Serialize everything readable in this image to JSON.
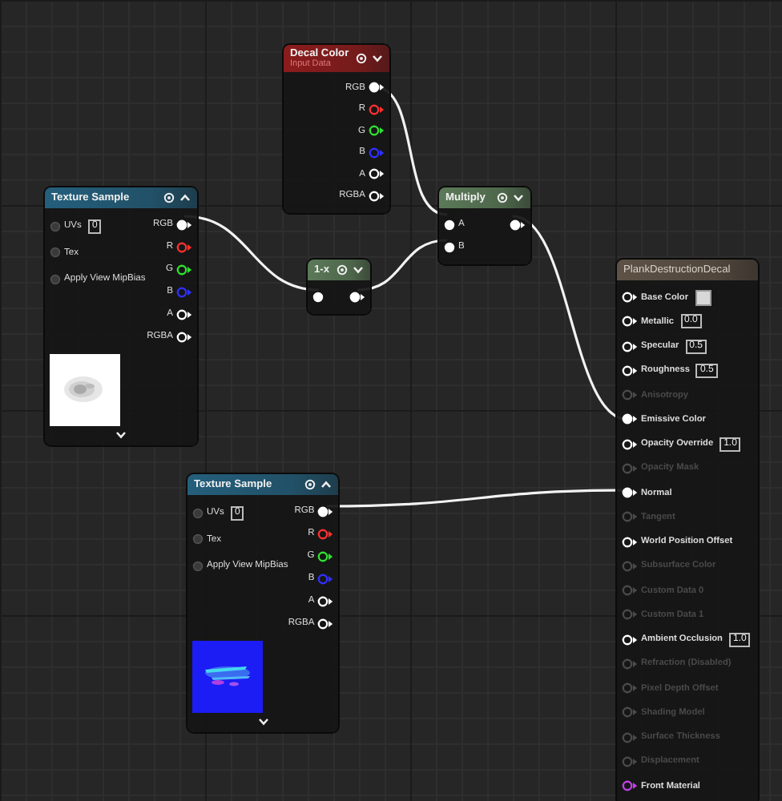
{
  "nodes": [
    {
      "kind": "input",
      "title": "Decal Color",
      "subtitle": "Input Data",
      "color": "#8c1c1c",
      "expanded": false,
      "outputs": [
        {
          "label": "RGB",
          "color": "#ffffff",
          "connected": true
        },
        {
          "label": "R",
          "color": "#ff3030",
          "connected": false
        },
        {
          "label": "G",
          "color": "#30e030",
          "connected": false
        },
        {
          "label": "B",
          "color": "#3030ff",
          "connected": false
        },
        {
          "label": "A",
          "color": "#ffffff",
          "connected": false
        },
        {
          "label": "RGBA",
          "color": "#ffffff",
          "connected": false
        }
      ]
    },
    {
      "kind": "texture",
      "title": "Texture Sample",
      "color": "#245f7c",
      "expanded": true,
      "inputs": [
        {
          "label": "UVs",
          "value": "0",
          "connected": false,
          "enabled": true
        },
        {
          "label": "Tex",
          "connected": false,
          "enabled": true
        },
        {
          "label": "Apply View MipBias",
          "connected": false,
          "enabled": true
        }
      ],
      "outputs": [
        {
          "label": "RGB",
          "color": "#ffffff",
          "connected": true
        },
        {
          "label": "R",
          "color": "#ff3030",
          "connected": false
        },
        {
          "label": "G",
          "color": "#30e030",
          "connected": false
        },
        {
          "label": "B",
          "color": "#3030ff",
          "connected": false
        },
        {
          "label": "A",
          "color": "#ffffff",
          "connected": false
        },
        {
          "label": "RGBA",
          "color": "#ffffff",
          "connected": false
        }
      ]
    },
    {
      "kind": "math",
      "title": "Multiply",
      "color": "#5b7a58",
      "expanded": false,
      "inputs": [
        {
          "label": "A",
          "connected": true,
          "enabled": true
        },
        {
          "label": "B",
          "connected": true,
          "enabled": true
        }
      ],
      "outputs": [
        {
          "color": "#ffffff",
          "connected": true
        }
      ]
    },
    {
      "kind": "math",
      "title": "1-x",
      "color": "#5b7a58",
      "expanded": false,
      "inputs": [
        {
          "connected": true,
          "enabled": true
        }
      ],
      "outputs": [
        {
          "color": "#ffffff",
          "connected": true
        }
      ]
    },
    {
      "kind": "result",
      "title": "PlankDestructionDecal",
      "color": "#5e5246",
      "inputs": [
        {
          "label": "Base Color",
          "kind": "swatch",
          "color": "#d8d8d8",
          "connected": false,
          "enabled": true
        },
        {
          "label": "Metallic",
          "value": "0.0",
          "connected": false,
          "enabled": true
        },
        {
          "label": "Specular",
          "value": "0.5",
          "connected": false,
          "enabled": true
        },
        {
          "label": "Roughness",
          "value": "0.5",
          "connected": false,
          "enabled": true
        },
        {
          "label": "Anisotropy",
          "connected": false,
          "enabled": false
        },
        {
          "label": "Emissive Color",
          "connected": true,
          "enabled": true
        },
        {
          "label": "Opacity Override",
          "value": "1.0",
          "connected": false,
          "enabled": true
        },
        {
          "label": "Opacity Mask",
          "connected": false,
          "enabled": false
        },
        {
          "label": "Normal",
          "connected": true,
          "enabled": true
        },
        {
          "label": "Tangent",
          "connected": false,
          "enabled": false
        },
        {
          "label": "World Position Offset",
          "connected": false,
          "enabled": true
        },
        {
          "label": "Subsurface Color",
          "connected": false,
          "enabled": false
        },
        {
          "label": "Custom Data 0",
          "connected": false,
          "enabled": false
        },
        {
          "label": "Custom Data 1",
          "connected": false,
          "enabled": false
        },
        {
          "label": "Ambient Occlusion",
          "value": "1.0",
          "connected": false,
          "enabled": true
        },
        {
          "label": "Refraction (Disabled)",
          "connected": false,
          "enabled": false
        },
        {
          "label": "Pixel Depth Offset",
          "connected": false,
          "enabled": false
        },
        {
          "label": "Shading Model",
          "connected": false,
          "enabled": false
        },
        {
          "label": "Surface Thickness",
          "connected": false,
          "enabled": false
        },
        {
          "label": "Displacement",
          "connected": false,
          "enabled": false
        },
        {
          "label": "Front Material",
          "kind": "pin",
          "color": "#c040e8",
          "connected": false,
          "enabled": true
        }
      ]
    },
    {
      "kind": "texture",
      "title": "Texture Sample",
      "color": "#245f7c",
      "expanded": true,
      "inputs": [
        {
          "label": "UVs",
          "value": "0",
          "connected": false,
          "enabled": true
        },
        {
          "label": "Tex",
          "connected": false,
          "enabled": true
        },
        {
          "label": "Apply View MipBias",
          "connected": false,
          "enabled": true
        }
      ],
      "outputs": [
        {
          "label": "RGB",
          "color": "#ffffff",
          "connected": true
        },
        {
          "label": "R",
          "color": "#ff3030",
          "connected": false
        },
        {
          "label": "G",
          "color": "#30e030",
          "connected": false
        },
        {
          "label": "B",
          "color": "#3030ff",
          "connected": false
        },
        {
          "label": "A",
          "color": "#ffffff",
          "connected": false
        },
        {
          "label": "RGBA",
          "color": "#ffffff",
          "connected": false
        }
      ]
    }
  ]
}
